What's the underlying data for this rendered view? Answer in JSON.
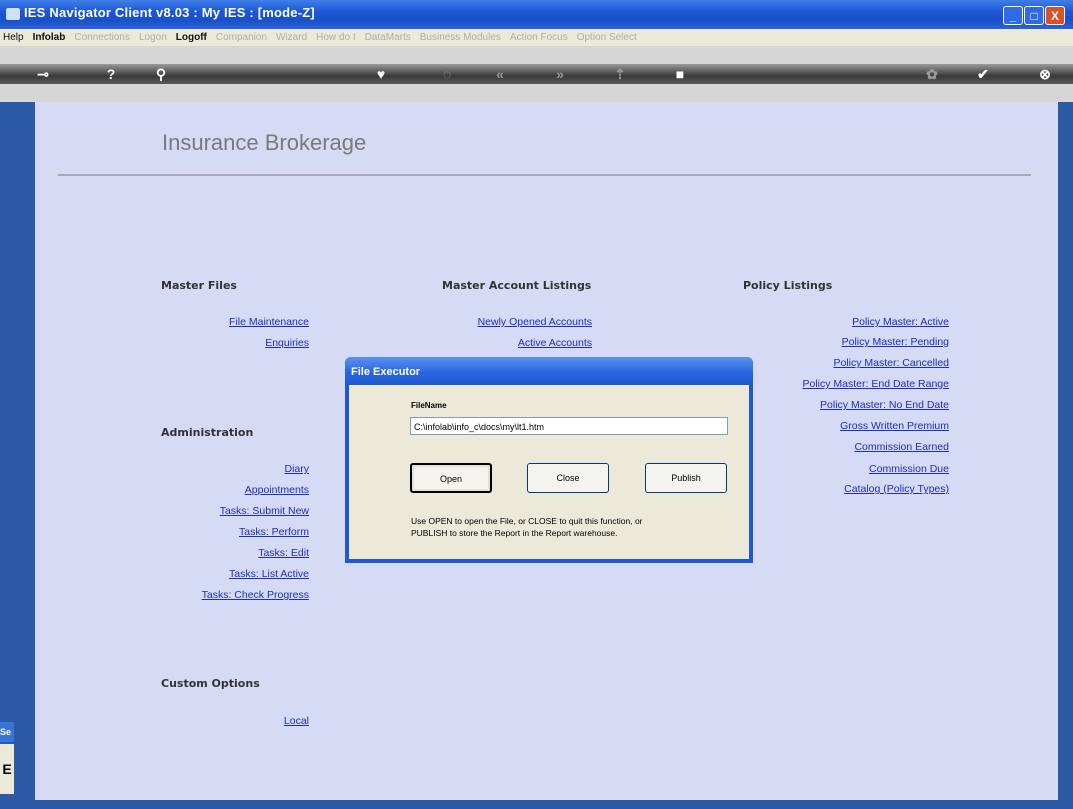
{
  "window": {
    "title": "IES Navigator Client v8.03 : My IES :      [mode-Z]",
    "buttons": {
      "minimize": "_",
      "maximize": "□",
      "close": "X"
    }
  },
  "menu": {
    "items": [
      "Help",
      "Infolab",
      "Connections",
      "Logon",
      "Logoff",
      "Companion",
      "Wizard",
      "How do I",
      "DataMarts",
      "Business Modules",
      "Action Focus",
      "Option Select"
    ]
  },
  "page": {
    "heading": "Insurance Brokerage"
  },
  "sections": {
    "master_files": {
      "title": "Master Files",
      "links": [
        "File Maintenance",
        "Enquiries"
      ]
    },
    "master_account_listings": {
      "title": "Master Account Listings",
      "links": [
        "Newly Opened Accounts",
        "Active Accounts"
      ]
    },
    "policy_listings": {
      "title": "Policy Listings",
      "links": [
        "Policy Master: Active",
        "Policy Master: Pending",
        "Policy Master: Cancelled",
        "Policy Master: End Date Range",
        "Policy Master: No End Date",
        "Gross Written Premium",
        "Commission Earned",
        "Commission Due",
        "Catalog (Policy Types)"
      ]
    },
    "administration": {
      "title": "Administration",
      "links": [
        "Diary",
        "Appointments",
        "Tasks: Submit New",
        "Tasks: Perform",
        "Tasks: Edit",
        "Tasks: List Active",
        "Tasks: Check Progress"
      ]
    },
    "custom_options": {
      "title": "Custom Options",
      "links": [
        "Local"
      ]
    }
  },
  "dialog": {
    "title": "File Executor",
    "field_label": "FileName",
    "filename": "C:\\infolab\\info_c\\docs\\my\\lt1.htm",
    "open_label": "Open",
    "close_label": "Close",
    "publish_label": "Publish",
    "message_line1": "Use OPEN to open the File, or CLOSE to quit this function, or",
    "message_line2": "PUBLISH to store the Report in the Report warehouse."
  },
  "side_tab": {
    "label": "Se",
    "glyph": "E"
  }
}
